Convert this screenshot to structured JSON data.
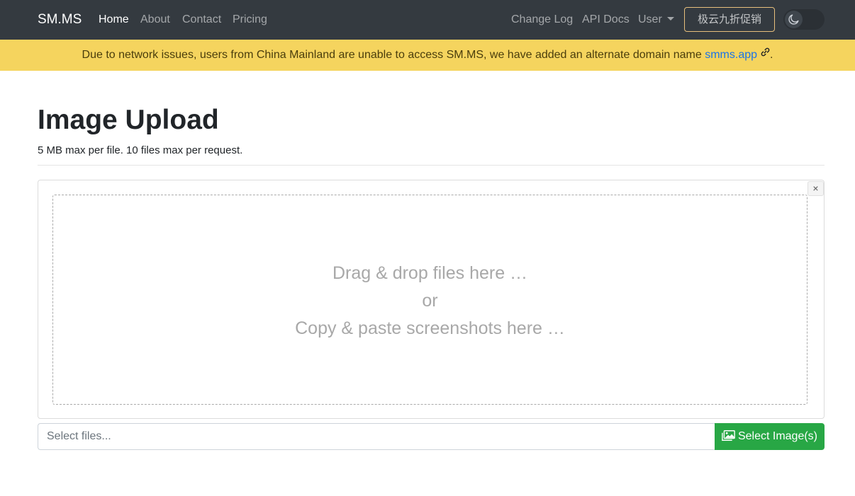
{
  "navbar": {
    "brand": "SM.MS",
    "links": [
      "Home",
      "About",
      "Contact",
      "Pricing"
    ],
    "right_links": [
      "Change Log",
      "API Docs"
    ],
    "user_menu": "User",
    "promo_button": "极云九折促销",
    "theme_toggle_icon": "moon-icon"
  },
  "alert": {
    "text": "Due to network issues, users from China Mainland are unable to access SM.MS, we have added an alternate domain name ",
    "link_text": "smms.app",
    "link_icon": "link-icon",
    "suffix": ".",
    "color": "#f5d45e"
  },
  "main": {
    "title": "Image Upload",
    "subtitle": "5 MB max per file. 10 files max per request."
  },
  "upload": {
    "close_label": "×",
    "drop_line1": "Drag & drop files here …",
    "drop_line2": "or",
    "drop_line3": "Copy & paste screenshots here …",
    "input_placeholder": "Select files...",
    "select_button": "Select Image(s)",
    "select_button_icon": "images-icon",
    "button_color": "#28a745"
  }
}
